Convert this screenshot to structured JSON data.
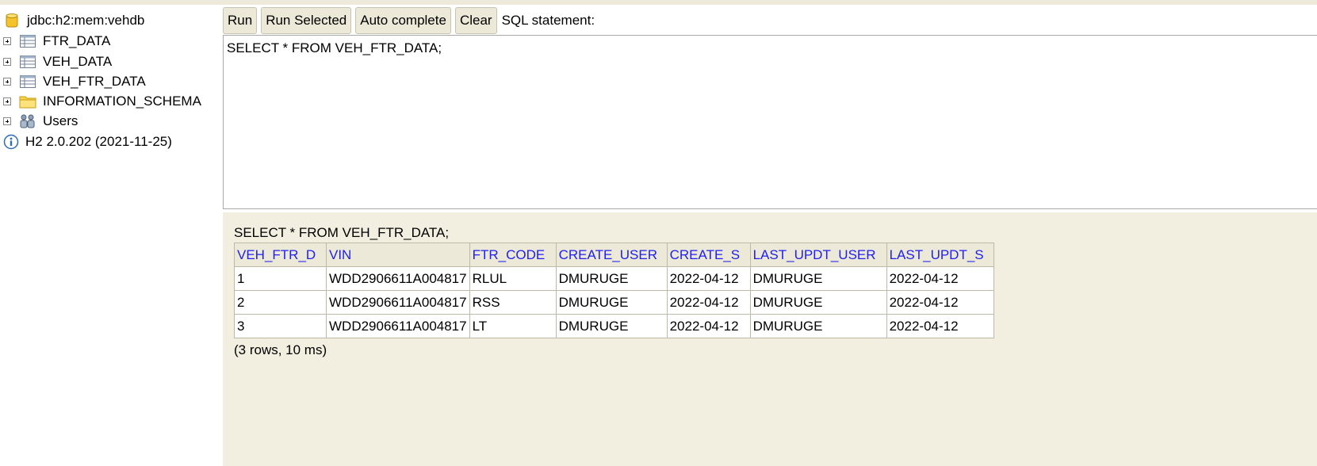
{
  "tree": {
    "connection": "jdbc:h2:mem:vehdb",
    "items": [
      {
        "label": "FTR_DATA",
        "icon": "table-icon"
      },
      {
        "label": "VEH_DATA",
        "icon": "table-icon"
      },
      {
        "label": "VEH_FTR_DATA",
        "icon": "table-icon"
      },
      {
        "label": "INFORMATION_SCHEMA",
        "icon": "folder-icon"
      },
      {
        "label": "Users",
        "icon": "users-icon"
      }
    ],
    "version": "H2 2.0.202 (2021-11-25)"
  },
  "toolbar": {
    "run": "Run",
    "run_selected": "Run Selected",
    "auto_complete": "Auto complete",
    "clear": "Clear",
    "sql_label": "SQL statement:"
  },
  "editor": {
    "value": "SELECT * FROM VEH_FTR_DATA;"
  },
  "results": {
    "query": "SELECT * FROM VEH_FTR_DATA;",
    "columns": [
      "VEH_FTR_D",
      "VIN",
      "FTR_CODE",
      "CREATE_USER",
      "CREATE_S",
      "LAST_UPDT_USER",
      "LAST_UPDT_S"
    ],
    "rows": [
      [
        "1",
        "WDD2906611A004817",
        "RLUL",
        "DMURUGE",
        "2022-04-12",
        "DMURUGE",
        "2022-04-12"
      ],
      [
        "2",
        "WDD2906611A004817",
        "RSS",
        "DMURUGE",
        "2022-04-12",
        "DMURUGE",
        "2022-04-12"
      ],
      [
        "3",
        "WDD2906611A004817",
        "LT",
        "DMURUGE",
        "2022-04-12",
        "DMURUGE",
        "2022-04-12"
      ]
    ],
    "summary": "(3 rows, 10 ms)"
  },
  "colors": {
    "header_text": "#2020f0",
    "results_bg": "#f2efe0",
    "button_bg": "#ece9d8"
  }
}
